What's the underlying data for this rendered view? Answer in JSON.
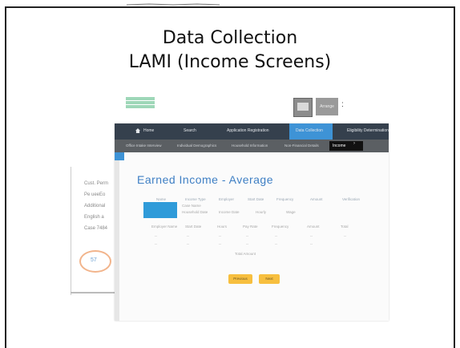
{
  "slide": {
    "title_line1": "Data Collection",
    "title_line2": "LAMI (Income Screens)"
  },
  "background_window": {
    "logo_text": "Ohio Benefits",
    "toolbar_button_label": "Arrange",
    "colon": ":"
  },
  "left_panel": {
    "items": [
      "Cust. Perm",
      "Pe  ueeEo",
      "Additional",
      "English  a",
      "Case 7484"
    ],
    "badge_text": "57"
  },
  "app": {
    "nav": {
      "items": [
        "Home",
        "Search",
        "Application Registration",
        "Data Collection",
        "Eligibility Determination"
      ],
      "active_index": 3
    },
    "subnav": {
      "tabs": [
        "Office Intake Interview",
        "Individual Demographics",
        "Household Information",
        "Non-Financial Details"
      ],
      "active_tab": "Income",
      "arrow": "›"
    },
    "page_heading": "Earned Income - Average",
    "table_headers": [
      "Name",
      "Income Type",
      "Employer",
      "Start Date",
      "Frequency",
      "Amount",
      "Verification"
    ],
    "rows": [
      [
        "Case  Name"
      ],
      [
        "Household  Date",
        "Income Date",
        "Hourly",
        "Wage"
      ],
      [
        "Employer Name",
        "Start Date",
        "Hours",
        "Pay Rate",
        "Frequency",
        "Amount",
        "Total"
      ],
      [
        "--",
        "--",
        "--",
        "--",
        "--",
        "--",
        "--"
      ],
      [
        "--",
        "--",
        "--",
        "--",
        "--",
        "--"
      ],
      [
        "Total Amount"
      ]
    ],
    "buttons": {
      "previous": "Previous",
      "next": "Next"
    },
    "colors": {
      "nav_bg": "#35404d",
      "active_blue": "#3e93d6",
      "button_yellow": "#f7bf3f"
    }
  }
}
